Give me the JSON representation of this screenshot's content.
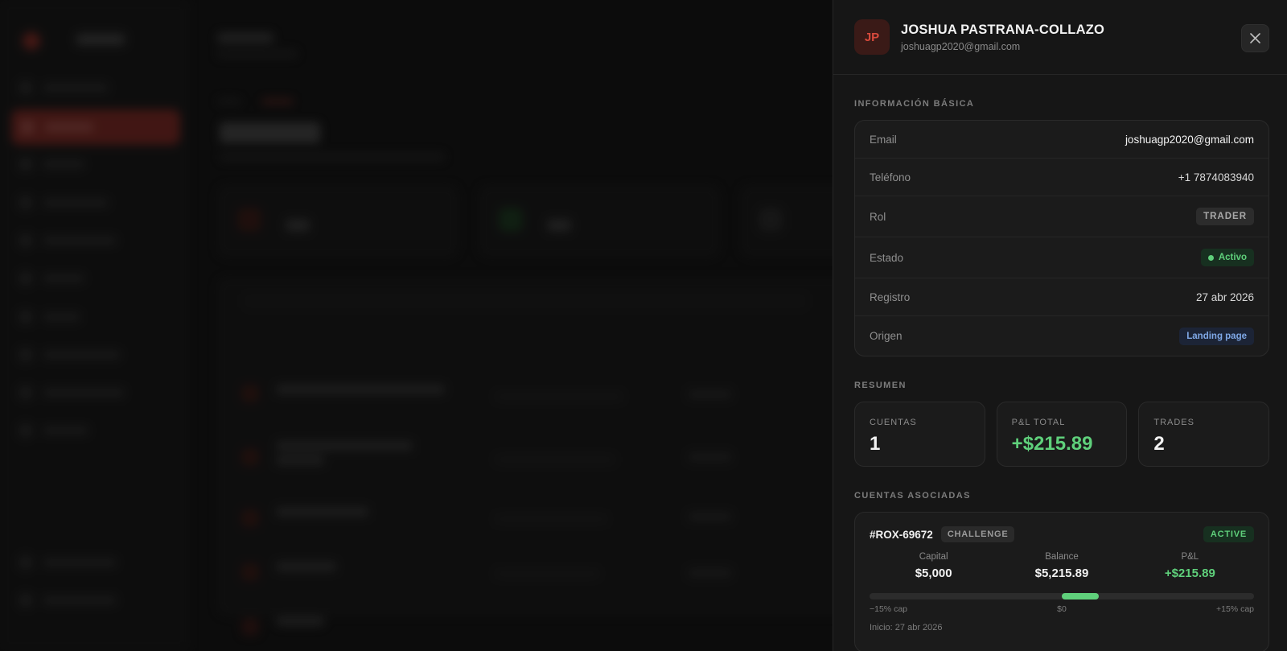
{
  "drawer": {
    "avatar_initials": "JP",
    "name": "JOSHUA PASTRANA-COLLAZO",
    "email": "joshuagp2020@gmail.com",
    "close_icon": "close-icon"
  },
  "basic_info": {
    "title": "INFORMACIÓN BÁSICA",
    "rows": {
      "email": {
        "label": "Email",
        "value": "joshuagp2020@gmail.com"
      },
      "phone": {
        "label": "Teléfono",
        "value": "+1 7874083940"
      },
      "role": {
        "label": "Rol",
        "value": "TRADER"
      },
      "status": {
        "label": "Estado",
        "value": "Activo"
      },
      "registered": {
        "label": "Registro",
        "value": "27 abr 2026"
      },
      "origin": {
        "label": "Origen",
        "value": "Landing page"
      }
    }
  },
  "summary": {
    "title": "RESUMEN",
    "accounts": {
      "label": "CUENTAS",
      "value": "1"
    },
    "pnl": {
      "label": "P&L TOTAL",
      "value": "+$215.89"
    },
    "trades": {
      "label": "TRADES",
      "value": "2"
    }
  },
  "linked_accounts": {
    "title": "CUENTAS ASOCIADAS",
    "account": {
      "id": "#ROX-69672",
      "type": "CHALLENGE",
      "status": "ACTIVE",
      "capital": {
        "label": "Capital",
        "value": "$5,000"
      },
      "balance": {
        "label": "Balance",
        "value": "$5,215.89"
      },
      "pnl": {
        "label": "P&L",
        "value": "+$215.89"
      },
      "range": {
        "min_label": "−15% cap",
        "mid_label": "$0",
        "max_label": "+15% cap",
        "pnl_fraction_of_cap": 0.0288
      },
      "start": "Inicio: 27 abr 2026"
    }
  },
  "colors": {
    "accent_red": "#b3362c",
    "positive_green": "#5fd07b",
    "origin_blue": "#7fa8e6"
  }
}
